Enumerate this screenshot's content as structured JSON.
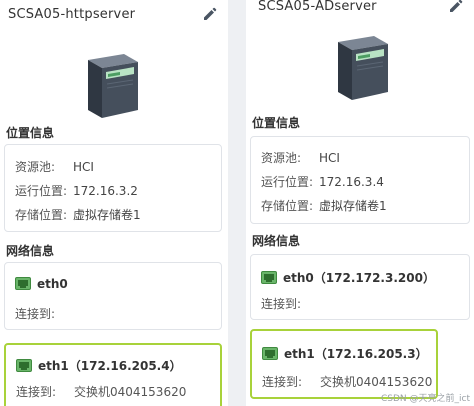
{
  "left": {
    "title": "SCSA05-httpserver",
    "location_title": "位置信息",
    "location": [
      {
        "key": "资源池:",
        "value": "HCI"
      },
      {
        "key": "运行位置:",
        "value": "172.16.3.2"
      },
      {
        "key": "存储位置:",
        "value": "虚拟存储卷1"
      }
    ],
    "network_title": "网络信息",
    "nics": [
      {
        "name": "eth0",
        "connected_label": "连接到:",
        "connected_value": ""
      },
      {
        "name": "eth1（172.16.205.4）",
        "connected_label": "连接到:",
        "connected_value": "交换机0404153620"
      }
    ]
  },
  "right": {
    "title": "SCSA05-ADserver",
    "location_title": "位置信息",
    "location": [
      {
        "key": "资源池:",
        "value": "HCI"
      },
      {
        "key": "运行位置:",
        "value": "172.16.3.4"
      },
      {
        "key": "存储位置:",
        "value": "虚拟存储卷1"
      }
    ],
    "network_title": "网络信息",
    "nics": [
      {
        "name": "eth0（172.172.3.200）",
        "connected_label": "连接到:",
        "connected_value": ""
      },
      {
        "name": "eth1（172.16.205.3）",
        "connected_label": "连接到:",
        "connected_value": "交换机0404153620"
      }
    ]
  },
  "watermark": "CSDN @天亮之前_ict",
  "colors": {
    "highlight": "#a8d23a",
    "nic_green": "#5aa05a",
    "server_dark": "#3d4652"
  }
}
